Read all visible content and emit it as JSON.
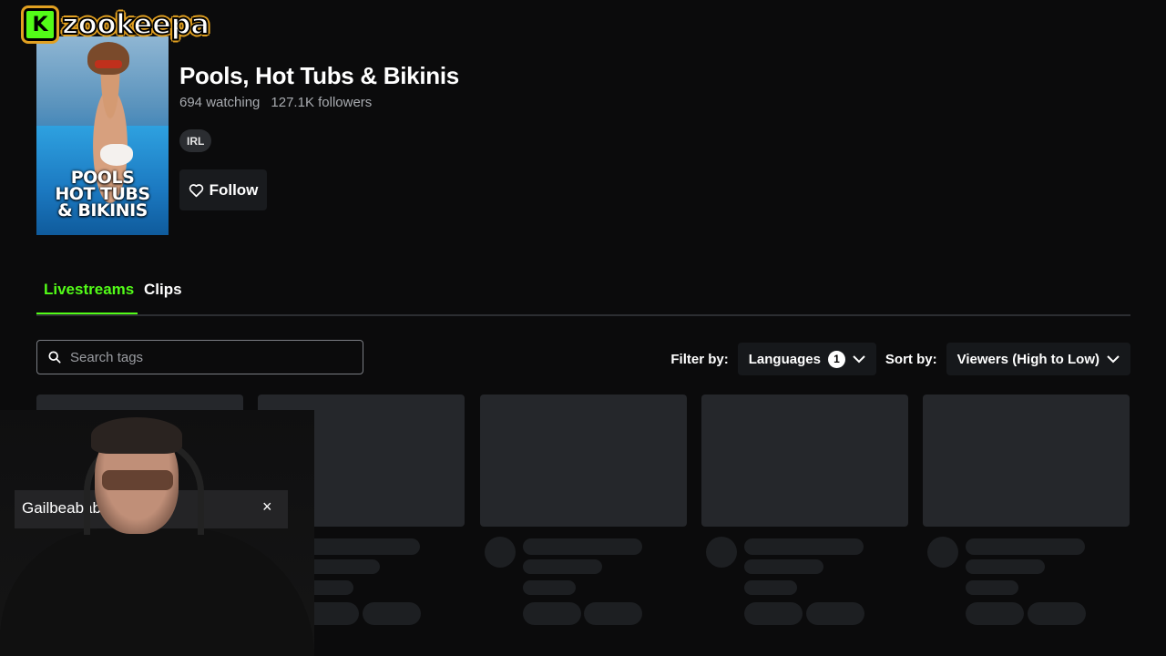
{
  "logo": {
    "badge": "K",
    "text": "zookeepa"
  },
  "category": {
    "cover_text": "POOLS\nHOT TUBS\n& BIKINIS",
    "title": "Pools, Hot Tubs & Bikinis",
    "watching": "694 watching",
    "followers": "127.1K followers",
    "tag": "IRL",
    "follow_label": "Follow"
  },
  "tabs": [
    {
      "label": "Livestreams",
      "active": true
    },
    {
      "label": "Clips",
      "active": false
    }
  ],
  "search": {
    "placeholder": "Search tags"
  },
  "filters": {
    "filter_label": "Filter by:",
    "languages_label": "Languages",
    "languages_count": "1",
    "sort_label": "Sort by:",
    "sort_value": "Viewers (High to Low)"
  },
  "webcam": {
    "name": "Gailbeababe",
    "close": "×"
  },
  "colors": {
    "accent": "#53fc18",
    "background": "#0b0b0c",
    "card": "#25272b"
  }
}
